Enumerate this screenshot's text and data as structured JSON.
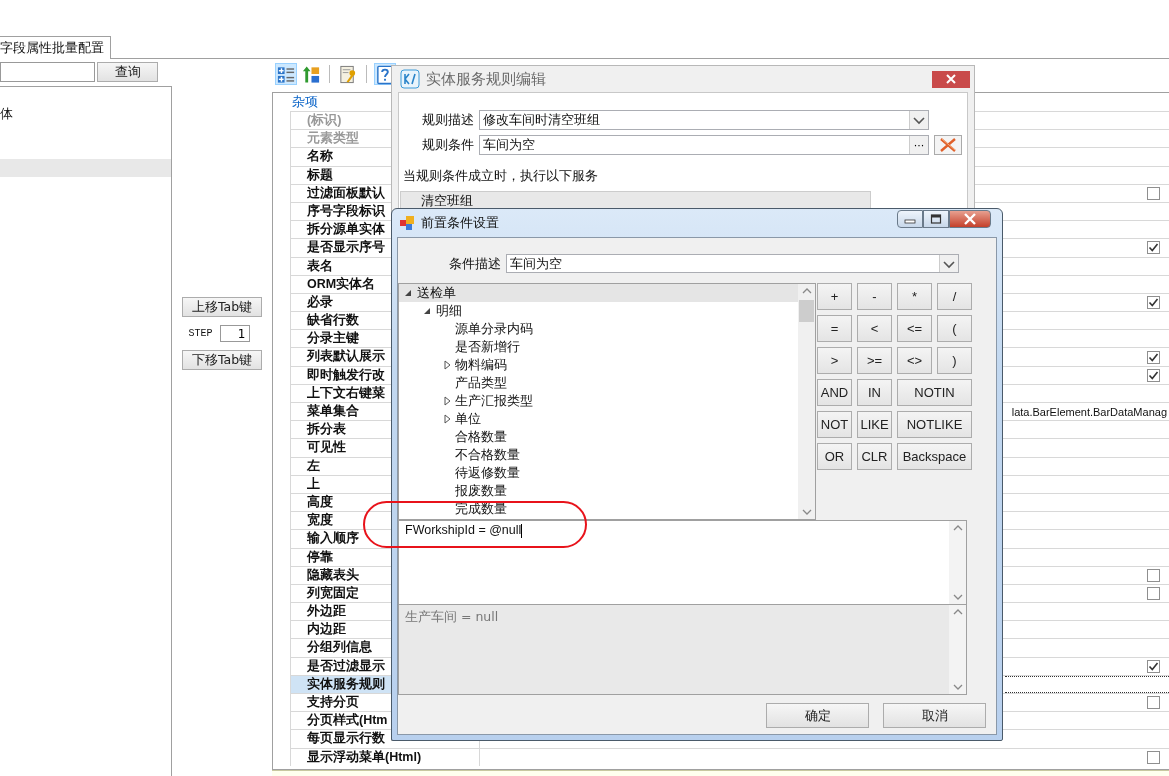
{
  "tabs": [
    {
      "label": "字段属性批量配置",
      "selected": true
    }
  ],
  "search": {
    "button": "查询"
  },
  "left_list": [
    {
      "label": "体",
      "selected": false
    },
    {
      "selected": true
    }
  ],
  "tab_order": {
    "up_button": "上移Tab键",
    "step_label": "STEP",
    "step_value": "1",
    "down_button": "下移Tab键"
  },
  "toolbar": [
    {
      "kind": "categorized",
      "selected": true
    },
    {
      "kind": "alphabetical",
      "selected": false
    },
    {
      "kind": "separator"
    },
    {
      "kind": "property_pages",
      "selected": false
    },
    {
      "kind": "separator"
    },
    {
      "kind": "help",
      "selected": true
    }
  ],
  "property_grid": {
    "category": "杂项",
    "rows": [
      {
        "name": "(标识)",
        "kind": "text",
        "selected": false,
        "disabled": true
      },
      {
        "name": "元素类型",
        "kind": "text",
        "selected": false,
        "disabled": true
      },
      {
        "name": "名称",
        "kind": "text",
        "selected": false,
        "disabled": false
      },
      {
        "name": "标题",
        "kind": "text",
        "selected": false,
        "disabled": false
      },
      {
        "name": "过滤面板默认",
        "kind": "checkbox",
        "checked": false,
        "selected": false,
        "disabled": false
      },
      {
        "name": "序号字段标识",
        "kind": "text",
        "selected": false,
        "disabled": false
      },
      {
        "name": "拆分源单实体",
        "kind": "text",
        "selected": false,
        "disabled": false
      },
      {
        "name": "是否显示序号",
        "kind": "checkbox",
        "checked": true,
        "selected": false,
        "disabled": false
      },
      {
        "name": "表名",
        "kind": "text",
        "selected": false,
        "disabled": false
      },
      {
        "name": "ORM实体名",
        "kind": "text",
        "selected": false,
        "disabled": false
      },
      {
        "name": "必录",
        "kind": "checkbox",
        "checked": true,
        "selected": false,
        "disabled": false
      },
      {
        "name": "缺省行数",
        "kind": "text",
        "selected": false,
        "disabled": false
      },
      {
        "name": "分录主键",
        "kind": "text",
        "selected": false,
        "disabled": false
      },
      {
        "name": "列表默认展示",
        "kind": "checkbox",
        "checked": true,
        "selected": false,
        "disabled": false
      },
      {
        "name": "即时触发行改",
        "kind": "checkbox",
        "checked": true,
        "selected": false,
        "disabled": false
      },
      {
        "name": "上下文右键菜",
        "kind": "text",
        "selected": false,
        "disabled": false
      },
      {
        "name": "菜单集合",
        "kind": "text",
        "value": "lata.BarElement.BarDataManag",
        "selected": false,
        "disabled": false
      },
      {
        "name": "拆分表",
        "kind": "text",
        "selected": false,
        "disabled": false
      },
      {
        "name": "可见性",
        "kind": "text",
        "selected": false,
        "disabled": false
      },
      {
        "name": "左",
        "kind": "text",
        "selected": false,
        "disabled": false
      },
      {
        "name": "上",
        "kind": "text",
        "selected": false,
        "disabled": false
      },
      {
        "name": "高度",
        "kind": "text",
        "selected": false,
        "disabled": false
      },
      {
        "name": "宽度",
        "kind": "text",
        "selected": false,
        "disabled": false
      },
      {
        "name": "输入顺序",
        "kind": "text",
        "selected": false,
        "disabled": false
      },
      {
        "name": "停靠",
        "kind": "text",
        "selected": false,
        "disabled": false
      },
      {
        "name": "隐藏表头",
        "kind": "checkbox",
        "checked": false,
        "selected": false,
        "disabled": false
      },
      {
        "name": "列宽固定",
        "kind": "checkbox",
        "checked": false,
        "selected": false,
        "disabled": false
      },
      {
        "name": "外边距",
        "kind": "text",
        "selected": false,
        "disabled": false
      },
      {
        "name": "内边距",
        "kind": "text",
        "selected": false,
        "disabled": false
      },
      {
        "name": "分组列信息",
        "kind": "text",
        "selected": false,
        "disabled": false
      },
      {
        "name": "是否过滤显示",
        "kind": "checkbox",
        "checked": true,
        "selected": false,
        "disabled": false
      },
      {
        "name": "实体服务规则",
        "kind": "text",
        "selected": true,
        "disabled": false
      },
      {
        "name": "支持分页",
        "kind": "checkbox",
        "checked": false,
        "selected": false,
        "disabled": false
      },
      {
        "name": "分页样式(Htm",
        "kind": "text",
        "selected": false,
        "disabled": false
      },
      {
        "name": "每页显示行数",
        "kind": "text",
        "selected": false,
        "disabled": false
      },
      {
        "name": "显示浮动菜单(Html)",
        "kind": "checkbox",
        "checked": false,
        "selected": false,
        "disabled": false
      }
    ]
  },
  "rule_dialog": {
    "title": "实体服务规则编辑",
    "description_label": "规则描述",
    "description_value": "修改车间时清空班组",
    "condition_label": "规则条件",
    "condition_value": "车间为空",
    "browse_button": "···",
    "info_text": "当规则条件成立时，执行以下服务",
    "services": [
      {
        "label": "清空班组"
      }
    ]
  },
  "condition_dialog": {
    "title": "前置条件设置",
    "description_label": "条件描述",
    "description_value": "车间为空",
    "tree": [
      {
        "label": "送检单",
        "kind": "group",
        "expanded": true,
        "selected": true,
        "children": [
          {
            "label": "明细",
            "kind": "group",
            "expanded": true,
            "selected": false,
            "children": [
              {
                "label": "源单分录内码",
                "kind": "field",
                "selected": false
              },
              {
                "label": "是否新增行",
                "kind": "field",
                "selected": false
              },
              {
                "label": "物料编码",
                "kind": "group",
                "expanded": false,
                "selected": false
              },
              {
                "label": "产品类型",
                "kind": "field",
                "selected": false
              },
              {
                "label": "生产汇报类型",
                "kind": "group",
                "expanded": false,
                "selected": false
              },
              {
                "label": "单位",
                "kind": "group",
                "expanded": false,
                "selected": false
              },
              {
                "label": "合格数量",
                "kind": "field",
                "selected": false
              },
              {
                "label": "不合格数量",
                "kind": "field",
                "selected": false
              },
              {
                "label": "待返修数量",
                "kind": "field",
                "selected": false
              },
              {
                "label": "报废数量",
                "kind": "field",
                "selected": false
              },
              {
                "label": "完成数量",
                "kind": "field",
                "selected": false
              }
            ]
          }
        ]
      }
    ],
    "operators": [
      {
        "label": "+",
        "kind": "normal"
      },
      {
        "label": "-",
        "kind": "normal"
      },
      {
        "label": "*",
        "kind": "normal"
      },
      {
        "label": "/",
        "kind": "normal"
      },
      {
        "label": "=",
        "kind": "normal"
      },
      {
        "label": "<",
        "kind": "normal"
      },
      {
        "label": "<=",
        "kind": "normal"
      },
      {
        "label": "(",
        "kind": "normal"
      },
      {
        "label": ">",
        "kind": "normal"
      },
      {
        "label": ">=",
        "kind": "normal"
      },
      {
        "label": "<>",
        "kind": "normal"
      },
      {
        "label": ")",
        "kind": "normal"
      },
      {
        "label": "AND",
        "kind": "normal"
      },
      {
        "label": "IN",
        "kind": "normal"
      },
      {
        "label": "NOTIN",
        "kind": "wide"
      },
      {
        "label": "NOT",
        "kind": "normal"
      },
      {
        "label": "LIKE",
        "kind": "normal"
      },
      {
        "label": "NOTLIKE",
        "kind": "wide"
      },
      {
        "label": "OR",
        "kind": "normal"
      },
      {
        "label": "CLR",
        "kind": "normal"
      },
      {
        "label": "Backspace",
        "kind": "wide"
      }
    ],
    "expression": "FWorkshipId = @null",
    "preview": "生产车间 = null",
    "buttons": [
      "确定",
      "取消"
    ]
  },
  "annotations": [
    {
      "kind": "ellipse"
    }
  ]
}
